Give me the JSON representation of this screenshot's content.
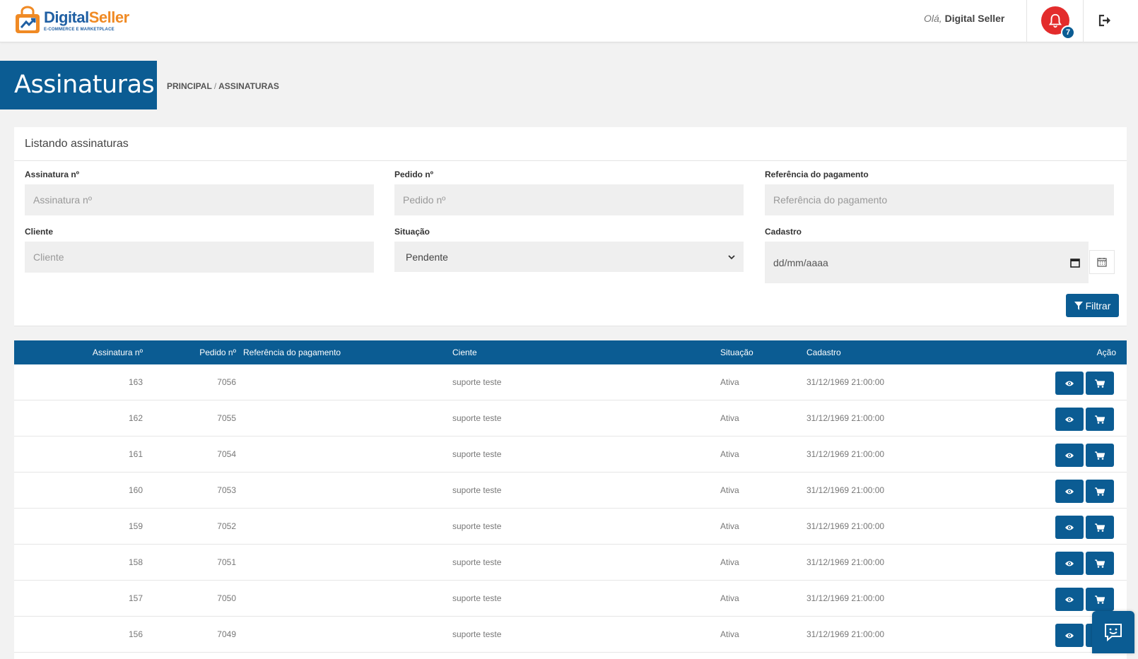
{
  "header": {
    "logo_name_a": "Digital",
    "logo_name_b": "Seller",
    "logo_sub": "E-COMMERCE E MARKETPLACE",
    "greeting_hi": "Olá,",
    "greeting_name": "Digital Seller",
    "notifications_count": "7"
  },
  "page": {
    "title": "Assinaturas",
    "breadcrumb": {
      "home": "PRINCIPAL",
      "separator": "/",
      "current": "ASSINATURAS"
    }
  },
  "filters": {
    "panel_title": "Listando assinaturas",
    "assinatura": {
      "label": "Assinatura nº",
      "placeholder": "Assinatura nº"
    },
    "pedido": {
      "label": "Pedido nº",
      "placeholder": "Pedido nº"
    },
    "referencia": {
      "label": "Referência do pagamento",
      "placeholder": "Referência do pagamento"
    },
    "cliente": {
      "label": "Cliente",
      "placeholder": "Cliente"
    },
    "situacao": {
      "label": "Situação",
      "value": "Pendente"
    },
    "cadastro": {
      "label": "Cadastro",
      "placeholder": "dd/mm/aaaa"
    },
    "filter_button": "Filtrar"
  },
  "table": {
    "columns": {
      "assinatura": "Assinatura nº",
      "pedido": "Pedido nº",
      "referencia": "Referência do pagamento",
      "cliente": "Ciente",
      "situacao": "Situação",
      "cadastro": "Cadastro",
      "acao": "Ação"
    },
    "rows": [
      {
        "assinatura": "163",
        "pedido": "7056",
        "referencia": "",
        "cliente": "suporte teste",
        "situacao": "Ativa",
        "cadastro": "31/12/1969 21:00:00"
      },
      {
        "assinatura": "162",
        "pedido": "7055",
        "referencia": "",
        "cliente": "suporte teste",
        "situacao": "Ativa",
        "cadastro": "31/12/1969 21:00:00"
      },
      {
        "assinatura": "161",
        "pedido": "7054",
        "referencia": "",
        "cliente": "suporte teste",
        "situacao": "Ativa",
        "cadastro": "31/12/1969 21:00:00"
      },
      {
        "assinatura": "160",
        "pedido": "7053",
        "referencia": "",
        "cliente": "suporte teste",
        "situacao": "Ativa",
        "cadastro": "31/12/1969 21:00:00"
      },
      {
        "assinatura": "159",
        "pedido": "7052",
        "referencia": "",
        "cliente": "suporte teste",
        "situacao": "Ativa",
        "cadastro": "31/12/1969 21:00:00"
      },
      {
        "assinatura": "158",
        "pedido": "7051",
        "referencia": "",
        "cliente": "suporte teste",
        "situacao": "Ativa",
        "cadastro": "31/12/1969 21:00:00"
      },
      {
        "assinatura": "157",
        "pedido": "7050",
        "referencia": "",
        "cliente": "suporte teste",
        "situacao": "Ativa",
        "cadastro": "31/12/1969 21:00:00"
      },
      {
        "assinatura": "156",
        "pedido": "7049",
        "referencia": "",
        "cliente": "suporte teste",
        "situacao": "Ativa",
        "cadastro": "31/12/1969 21:00:00"
      }
    ]
  },
  "icons": {
    "bell": "bell-icon",
    "logout": "logout-icon",
    "calendar": "calendar-icon",
    "filter": "filter-icon",
    "view": "eye-icon",
    "order": "cart-icon",
    "chat": "chat-icon"
  },
  "colors": {
    "primary": "#0b5c93",
    "alert": "#e32c2c",
    "brand_orange": "#f08a24"
  }
}
